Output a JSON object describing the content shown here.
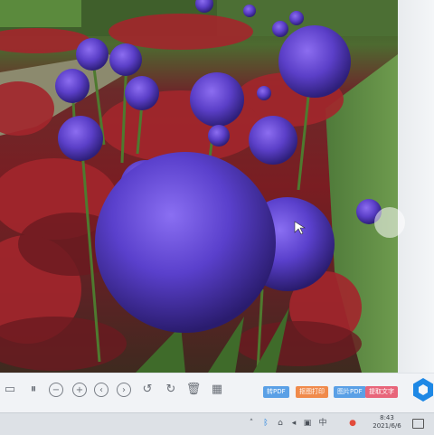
{
  "toolbar": {
    "tools": [
      {
        "name": "slideshow-icon",
        "glyph": "▭"
      },
      {
        "name": "pause-icon",
        "glyph": "⏸"
      },
      {
        "name": "zoom-out-icon",
        "glyph": "−"
      },
      {
        "name": "zoom-in-icon",
        "glyph": "+"
      },
      {
        "name": "previous-icon",
        "glyph": "‹"
      },
      {
        "name": "next-icon",
        "glyph": "›"
      },
      {
        "name": "rotate-left-icon",
        "glyph": "↺"
      },
      {
        "name": "rotate-right-icon",
        "glyph": "↻"
      },
      {
        "name": "delete-icon",
        "glyph": "🗑"
      },
      {
        "name": "apps-icon",
        "glyph": "▦"
      }
    ],
    "action_buttons": [
      {
        "label": "转PDF",
        "color": "#5aa0e6"
      },
      {
        "label": "抠图打印",
        "color": "#f08a4b"
      },
      {
        "label": "图片PDF",
        "color": "#5aa0e6"
      },
      {
        "label": "提取文字",
        "color": "#e8657a"
      }
    ]
  },
  "taskbar": {
    "time": "8:43",
    "date": "2021/6/6",
    "tray_icons": [
      "chevron-up-icon",
      "bluetooth-icon",
      "network-icon",
      "volume-icon",
      "input-method-icon",
      "ime-label-icon",
      "app-icon"
    ],
    "ime_label": "中"
  },
  "colors": {
    "toolbar_bg": "#f1f3f6",
    "taskbar_bg": "#dde1e6",
    "logo": "#1e88e5"
  }
}
